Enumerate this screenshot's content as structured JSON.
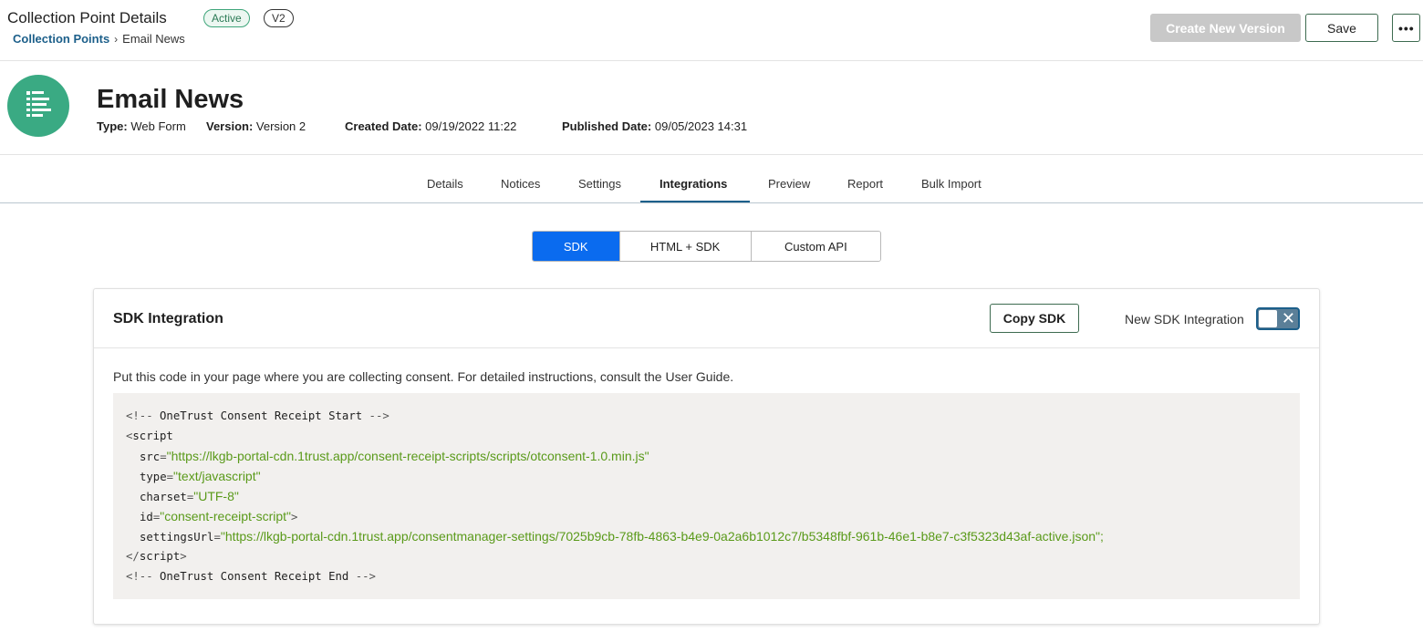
{
  "header": {
    "title": "Collection Point Details",
    "status_badge": "Active",
    "version_badge": "V2",
    "breadcrumb": {
      "parent": "Collection Points",
      "separator": "›",
      "current": "Email News"
    },
    "create_version_label": "Create New Version",
    "save_label": "Save",
    "more_label": "•••"
  },
  "record": {
    "name": "Email News",
    "meta": [
      {
        "label": "Type:",
        "value": "Web Form"
      },
      {
        "label": "Version:",
        "value": "Version 2"
      },
      {
        "label": "Created Date:",
        "value": "09/19/2022 11:22"
      },
      {
        "label": "Published Date:",
        "value": "09/05/2023 14:31"
      }
    ],
    "icon": "form-list-icon",
    "icon_color": "#3aaa83"
  },
  "tabs": [
    {
      "label": "Details"
    },
    {
      "label": "Notices"
    },
    {
      "label": "Settings"
    },
    {
      "label": "Integrations",
      "active": true
    },
    {
      "label": "Preview"
    },
    {
      "label": "Report"
    },
    {
      "label": "Bulk Import"
    }
  ],
  "integration_types": [
    {
      "label": "SDK",
      "active": true
    },
    {
      "label": "HTML + SDK"
    },
    {
      "label": "Custom API"
    }
  ],
  "sdk_card": {
    "title": "SDK Integration",
    "copy_label": "Copy SDK",
    "toggle_label": "New SDK Integration",
    "toggle_on": false,
    "instructions": "Put this code in your page where you are collecting consent. For detailed instructions, consult the User Guide.",
    "code": {
      "comment_start": "OneTrust Consent Receipt Start",
      "tag": "script",
      "attrs": [
        {
          "name": "src",
          "value": "https://lkgb-portal-cdn.1trust.app/consent-receipt-scripts/scripts/otconsent-1.0.min.js"
        },
        {
          "name": "type",
          "value": "text/javascript"
        },
        {
          "name": "charset",
          "value": "UTF-8"
        },
        {
          "name": "id",
          "value": "consent-receipt-script"
        },
        {
          "name": "settingsUrl",
          "value": "https://lkgb-portal-cdn.1trust.app/consentmanager-settings/7025b9cb-78fb-4863-b4e9-0a2a6b1012c7/b5348fbf-961b-46e1-b8e7-c3f5323d43af-active.json"
        }
      ],
      "comment_end": "OneTrust Consent Receipt End"
    }
  },
  "colors": {
    "accent": "#0a6bef",
    "tab_underline": "#1c5f8a",
    "code_string": "#5a9a1a",
    "code_bg": "#f2f0ee"
  }
}
